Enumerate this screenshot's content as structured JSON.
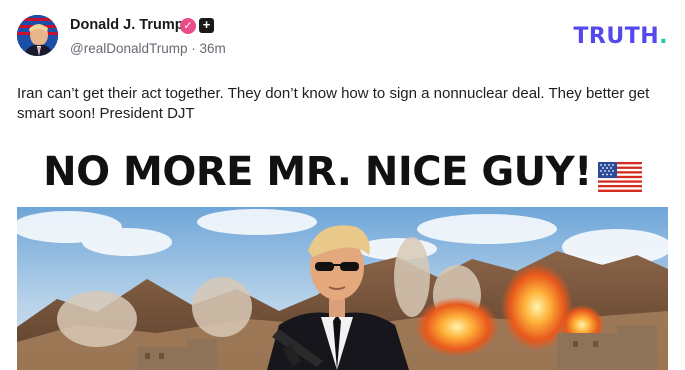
{
  "post": {
    "display_name": "Donald J. Trump",
    "verified_icon": "check-icon",
    "badge_icon": "plus-icon",
    "handle": "@realDonaldTrump",
    "separator": "·",
    "time_ago": "36m",
    "brand": "TRUTH",
    "brand_dot": ".",
    "text": "Iran can’t get their act together. They don’t know how to sign a nonnuclear deal. They better get smart soon! President DJT",
    "media": {
      "headline": "NO MORE MR. NICE GUY!",
      "flag_icon": "us-flag-icon"
    }
  },
  "colors": {
    "brand": "#5448ee",
    "brand_dot": "#1fc9a7",
    "verified": "#ea4c89"
  }
}
